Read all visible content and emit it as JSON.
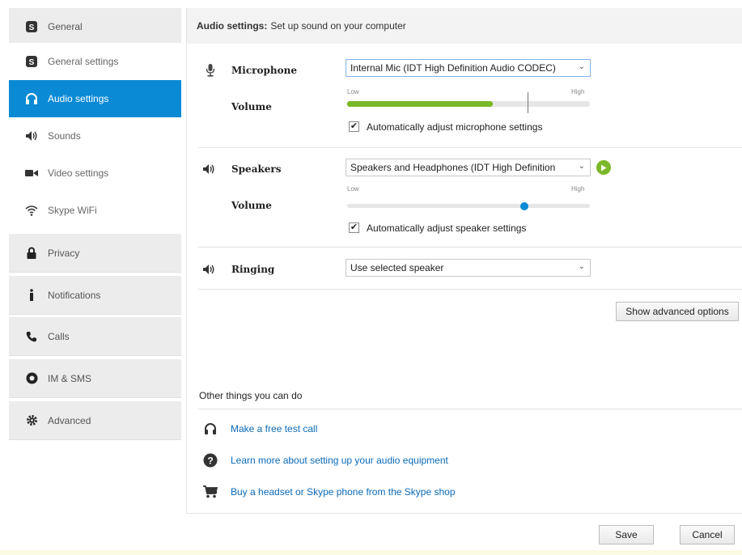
{
  "sidebar": {
    "general": "General",
    "sub_items": [
      {
        "label": "General settings",
        "icon": "skype-icon"
      },
      {
        "label": "Audio settings",
        "icon": "headset-icon"
      },
      {
        "label": "Sounds",
        "icon": "speaker-icon"
      },
      {
        "label": "Video settings",
        "icon": "video-camera-icon"
      },
      {
        "label": "Skype WiFi",
        "icon": "wifi-icon"
      }
    ],
    "categories": [
      {
        "label": "Privacy",
        "icon": "lock-icon"
      },
      {
        "label": "Notifications",
        "icon": "info-icon"
      },
      {
        "label": "Calls",
        "icon": "phone-icon"
      },
      {
        "label": "IM & SMS",
        "icon": "chat-icon"
      },
      {
        "label": "Advanced",
        "icon": "gear-icon"
      }
    ],
    "active_index": 1,
    "accent_color": "#0a8ad4"
  },
  "header": {
    "title_bold": "Audio settings:",
    "title_rest": "Set up sound on your computer"
  },
  "microphone": {
    "label": "Microphone",
    "device": "Internal Mic (IDT High Definition Audio CODEC)",
    "volume_label": "Volume",
    "low": "Low",
    "high": "High",
    "level_fraction": 0.6,
    "auto_label": "Automatically adjust microphone settings",
    "auto_checked": true
  },
  "speakers": {
    "label": "Speakers",
    "device": "Speakers and Headphones (IDT High Definition",
    "volume_label": "Volume",
    "low": "Low",
    "high": "High",
    "level_fraction": 0.73,
    "auto_label": "Automatically adjust speaker settings",
    "auto_checked": true
  },
  "ringing": {
    "label": "Ringing",
    "device": "Use selected speaker"
  },
  "advanced_button": "Show advanced options",
  "other": {
    "heading": "Other things you can do",
    "links": [
      {
        "label": "Make a free test call",
        "icon": "headset-icon"
      },
      {
        "label": "Learn more about setting up your audio equipment",
        "icon": "help-icon"
      },
      {
        "label": "Buy a headset or Skype phone from the Skype shop",
        "icon": "cart-icon"
      }
    ]
  },
  "footer": {
    "save": "Save",
    "cancel": "Cancel"
  }
}
